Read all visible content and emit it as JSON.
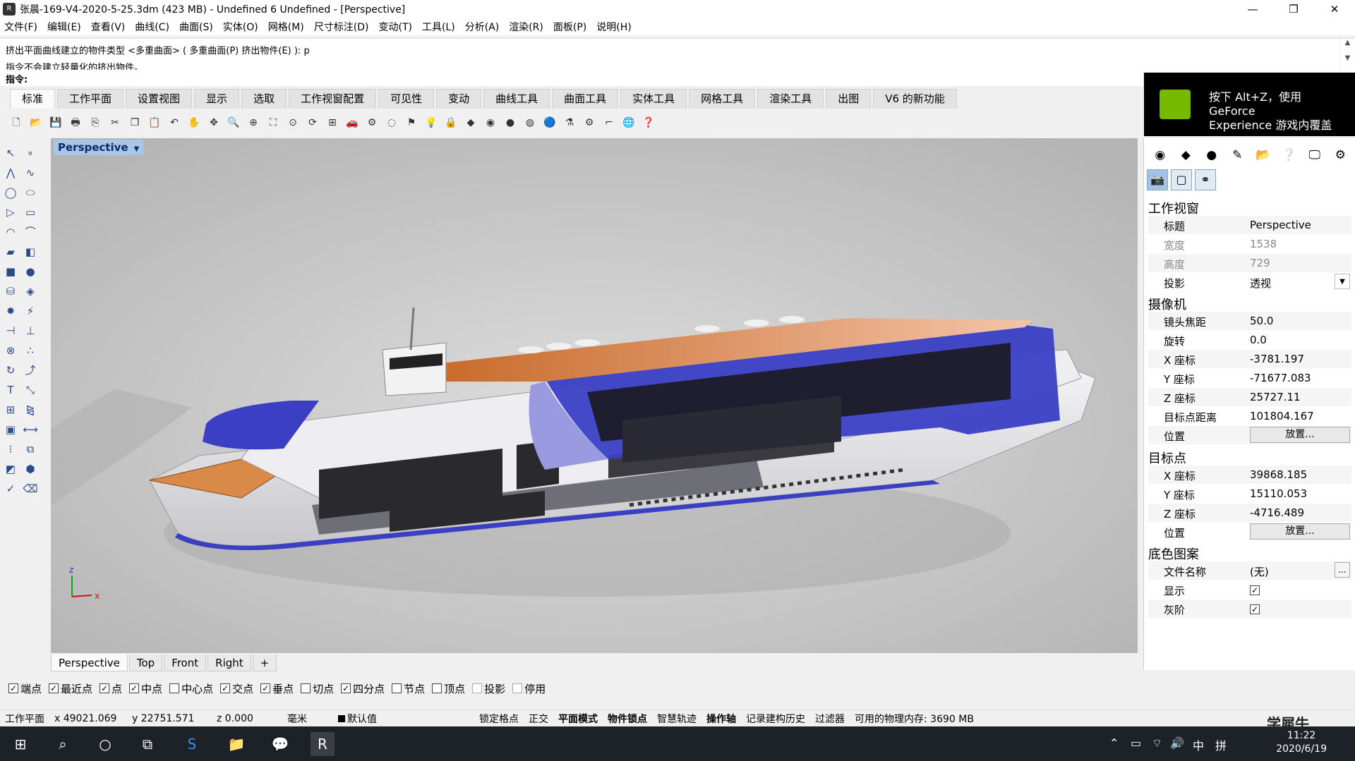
{
  "window": {
    "title": "张晨-169-V4-2020-5-25.3dm (423 MB) - Undefined 6 Undefined - [Perspective]",
    "minimize": "—",
    "maximize": "❐",
    "close": "✕"
  },
  "menu": [
    "文件(F)",
    "编辑(E)",
    "查看(V)",
    "曲线(C)",
    "曲面(S)",
    "实体(O)",
    "网格(M)",
    "尺寸标注(D)",
    "变动(T)",
    "工具(L)",
    "分析(A)",
    "渲染(R)",
    "面板(P)",
    "说明(H)"
  ],
  "command_history": {
    "line1": "挤出平面曲线建立的物件类型 <多重曲面> ( 多重曲面(P)  挤出物件(E) ): p",
    "line2": "指令不会建立轻量化的挤出物件。",
    "prompt": "指令:"
  },
  "toolbar_tabs": [
    "标准",
    "工作平面",
    "设置视图",
    "显示",
    "选取",
    "工作视窗配置",
    "可见性",
    "变动",
    "曲线工具",
    "曲面工具",
    "实体工具",
    "网格工具",
    "渲染工具",
    "出图",
    "V6 的新功能"
  ],
  "nvidia": {
    "text_line1": "按下 Alt+Z，使用 GeForce",
    "text_line2": "Experience 游戏内覆盖"
  },
  "viewport": {
    "title": "Perspective",
    "axis_x": "x",
    "axis_z": "z"
  },
  "viewport_tabs": [
    "Perspective",
    "Top",
    "Front",
    "Right",
    "+"
  ],
  "osnaps": [
    {
      "label": "端点",
      "checked": true
    },
    {
      "label": "最近点",
      "checked": true
    },
    {
      "label": "点",
      "checked": true
    },
    {
      "label": "中点",
      "checked": true
    },
    {
      "label": "中心点",
      "checked": false
    },
    {
      "label": "交点",
      "checked": true
    },
    {
      "label": "垂点",
      "checked": true
    },
    {
      "label": "切点",
      "checked": false
    },
    {
      "label": "四分点",
      "checked": true
    },
    {
      "label": "节点",
      "checked": false
    },
    {
      "label": "顶点",
      "checked": false
    },
    {
      "label": "投影",
      "checked": false
    },
    {
      "label": "停用",
      "checked": false
    }
  ],
  "status": {
    "cplane": "工作平面",
    "x": "x 49021.069",
    "y": "y 22751.571",
    "z": "z 0.000",
    "unit": "毫米",
    "layer": "默认值",
    "grid_snap": "锁定格点",
    "ortho": "正交",
    "planar": "平面模式",
    "osnap": "物件锁点",
    "smarttrack": "智慧轨迹",
    "gumball": "操作轴",
    "history": "记录建构历史",
    "filter": "过滤器",
    "memory": "可用的物理内存: 3690 MB"
  },
  "panel": {
    "viewport_section": "工作视窗",
    "title_label": "标题",
    "title_value": "Perspective",
    "width_label": "宽度",
    "width_value": "1538",
    "height_label": "高度",
    "height_value": "729",
    "projection_label": "投影",
    "projection_value": "透视",
    "camera_section": "摄像机",
    "lens_label": "镜头焦距",
    "lens_value": "50.0",
    "rotation_label": "旋转",
    "rotation_value": "0.0",
    "cam_x_label": "X 座标",
    "cam_x_value": "-3781.197",
    "cam_y_label": "Y 座标",
    "cam_y_value": "-71677.083",
    "cam_z_label": "Z 座标",
    "cam_z_value": "25727.11",
    "target_dist_label": "目标点距离",
    "target_dist_value": "101804.167",
    "location_label": "位置",
    "place_button": "放置...",
    "target_section": "目标点",
    "tgt_x_label": "X 座标",
    "tgt_x_value": "39868.185",
    "tgt_y_label": "Y 座标",
    "tgt_y_value": "15110.053",
    "tgt_z_label": "Z 座标",
    "tgt_z_value": "-4716.489",
    "tgt_location_label": "位置",
    "tgt_place_button": "放置...",
    "wallpaper_section": "底色图案",
    "filename_label": "文件名称",
    "filename_value": "(无)",
    "browse_button": "...",
    "show_label": "显示",
    "show_checked": true,
    "gray_label": "灰阶",
    "gray_checked": true
  },
  "taskbar": {
    "time": "11:22",
    "date": "2020/6/19",
    "ime": "中",
    "watermark": "学犀牛"
  },
  "colors": {
    "viewport_bg": "#c2c2c2",
    "hull_blue": "#3a3fc4",
    "deck_orange": "#d98a48",
    "nvidia_green": "#76b900"
  }
}
